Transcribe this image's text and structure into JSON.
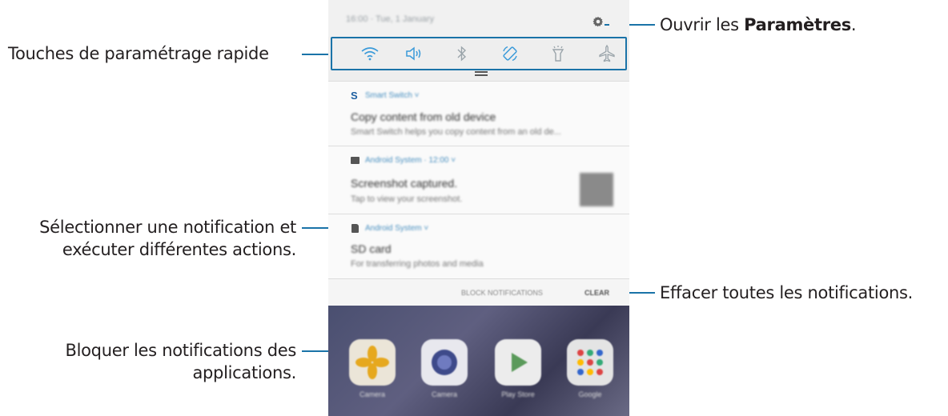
{
  "callouts": {
    "quick_settings": "Touches de paramétrage rapide",
    "settings_prefix": "Ouvrir les ",
    "settings_bold": "Paramètres",
    "settings_suffix": ".",
    "select_notification_line1": "Sélectionner une notification et",
    "select_notification_line2": "exécuter différentes actions.",
    "clear_all": "Effacer toutes les notifications.",
    "block_line1": "Bloquer les notifications des",
    "block_line2": "applications."
  },
  "colors": {
    "callout_line": "#1a73a8",
    "quick_icon_active": "#3a9ad9",
    "quick_icon_inactive": "#9aa4aa"
  },
  "phone": {
    "status": {
      "time_date": "16:00 · Tue, 1 January",
      "settings_icon": "gear-icon"
    },
    "quick_settings": [
      {
        "icon": "wifi-icon",
        "active": true
      },
      {
        "icon": "sound-icon",
        "active": true
      },
      {
        "icon": "bluetooth-icon",
        "active": false
      },
      {
        "icon": "auto-rotate-icon",
        "active": true
      },
      {
        "icon": "flashlight-icon",
        "active": false
      },
      {
        "icon": "airplane-mode-icon",
        "active": false
      }
    ],
    "notifications": [
      {
        "icon": "smart-switch-icon",
        "app": "Smart Switch ˅",
        "title": "Copy content from old device",
        "body": "Smart Switch helps you copy content from an old de..."
      },
      {
        "icon": "image-icon",
        "app": "Android System · 12:00 ˅",
        "title": "Screenshot captured.",
        "body": "Tap to view your screenshot."
      },
      {
        "icon": "sd-card-icon",
        "app": "Android System ˅",
        "title": "SD card",
        "body": "For transferring photos and media"
      }
    ],
    "actions": {
      "block": "BLOCK NOTIFICATIONS",
      "clear": "CLEAR"
    },
    "home_apps": [
      {
        "label": "Camera",
        "icon": "flower-app-icon",
        "color": "#e9e4da"
      },
      {
        "label": "Camera",
        "icon": "camera-app-icon",
        "color": "#e8e8ee"
      },
      {
        "label": "Play Store",
        "icon": "play-store-app-icon",
        "color": "#ececec"
      },
      {
        "label": "Google",
        "icon": "google-folder-icon",
        "color": "#e4e4e4"
      }
    ]
  }
}
